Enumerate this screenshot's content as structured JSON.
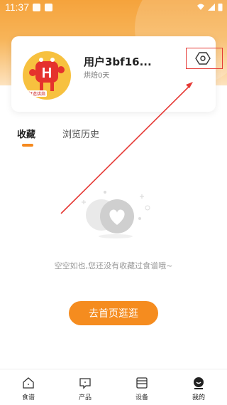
{
  "status_bar": {
    "time": "11:37"
  },
  "profile": {
    "username": "用户3bf16...",
    "bake_days": "烘焙0天",
    "avatar_letter": "H",
    "avatar_tag": "打造烘焙"
  },
  "tabs": [
    {
      "label": "收藏",
      "active": true
    },
    {
      "label": "浏览历史",
      "active": false
    }
  ],
  "empty_state": {
    "message": "空空如也,您还没有收藏过食谱哦~"
  },
  "home_button": {
    "label": "去首页逛逛"
  },
  "bottom_nav": [
    {
      "label": "食谱",
      "icon": "home-icon"
    },
    {
      "label": "产品",
      "icon": "message-icon"
    },
    {
      "label": "设备",
      "icon": "device-icon"
    },
    {
      "label": "我的",
      "icon": "profile-icon",
      "active": true
    }
  ],
  "colors": {
    "accent": "#f58c1f",
    "annotation": "#e53935"
  }
}
